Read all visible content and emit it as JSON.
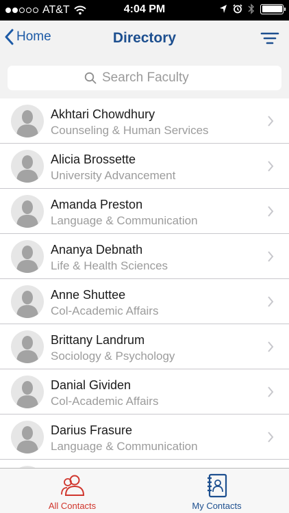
{
  "status_bar": {
    "carrier": "AT&T",
    "time": "4:04 PM"
  },
  "nav": {
    "back_label": "Home",
    "title": "Directory"
  },
  "search": {
    "placeholder": "Search Faculty",
    "value": ""
  },
  "contacts": [
    {
      "name": "Akhtari Chowdhury",
      "department": "Counseling & Human Services"
    },
    {
      "name": "Alicia Brossette",
      "department": "University Advancement"
    },
    {
      "name": "Amanda Preston",
      "department": "Language & Communication"
    },
    {
      "name": "Ananya Debnath",
      "department": "Life & Health Sciences"
    },
    {
      "name": "Anne Shuttee",
      "department": "Col-Academic Affairs"
    },
    {
      "name": "Brittany Landrum",
      "department": "Sociology & Psychology"
    },
    {
      "name": "Danial Gividen",
      "department": "Col-Academic Affairs"
    },
    {
      "name": "Darius Frasure",
      "department": "Language & Communication"
    }
  ],
  "tabs": [
    {
      "label": "All Contacts",
      "icon": "people-icon",
      "active": true
    },
    {
      "label": "My Contacts",
      "icon": "address-book-icon",
      "active": false
    }
  ],
  "colors": {
    "accent_blue": "#1d4f8f",
    "accent_red": "#d0352c",
    "subtitle_gray": "#9c9c9c"
  }
}
